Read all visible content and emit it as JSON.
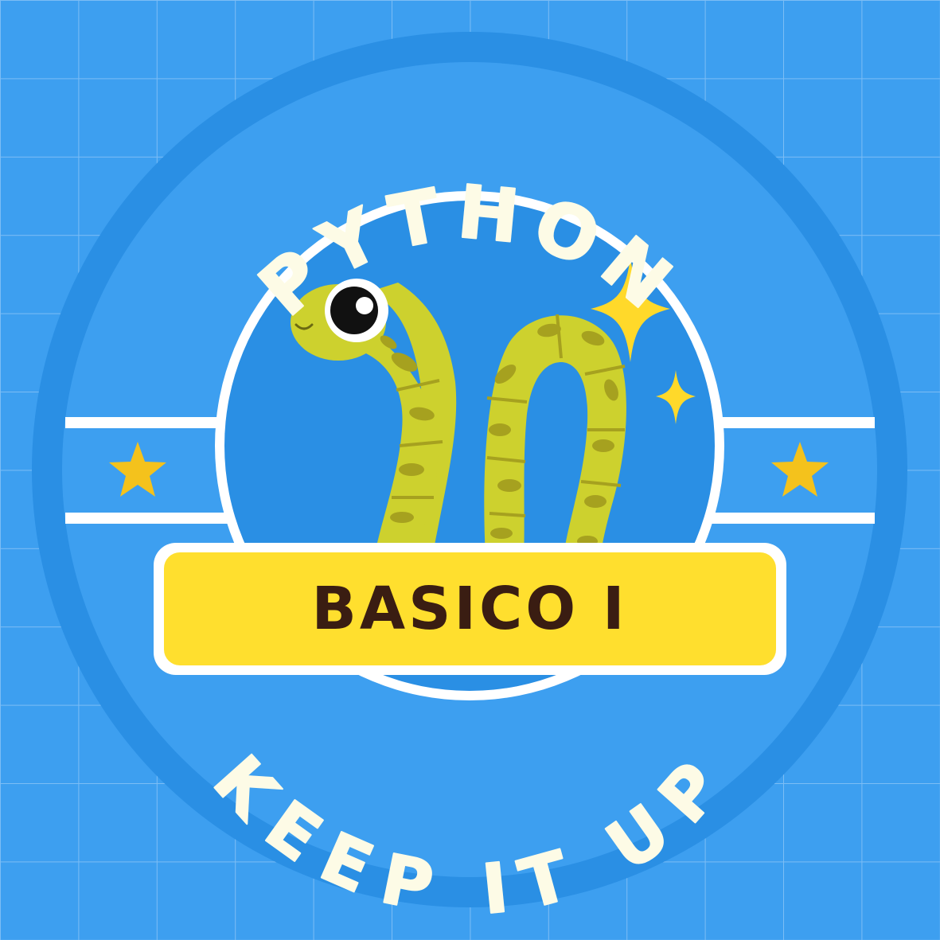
{
  "badge": {
    "top_text": "PYTHON",
    "bottom_text": "KEEP IT UP",
    "banner_label": "BASICO I"
  },
  "icons": {
    "mascot": "snake-mascot-icon",
    "sparkle_large": "sparkle-large-icon",
    "sparkle_small": "sparkle-small-icon",
    "star_left": "star-icon",
    "star_right": "star-icon"
  },
  "colors": {
    "background": "#3d9ff0",
    "grid_line": "#7cbdf5",
    "outer_ring": "#2a8fe4",
    "inner_disc": "#3d9ff0",
    "center_disc": "#2a8fe4",
    "white_stroke": "#ffffff",
    "banner_fill": "#ffdf2e",
    "banner_text": "#3a1d12",
    "snake_body": "#cdd12e",
    "snake_spots": "#a6a11f",
    "star_fill": "#f4c21c",
    "sparkle_fill": "#ffd92a",
    "arc_text": "#fdfbe6"
  }
}
